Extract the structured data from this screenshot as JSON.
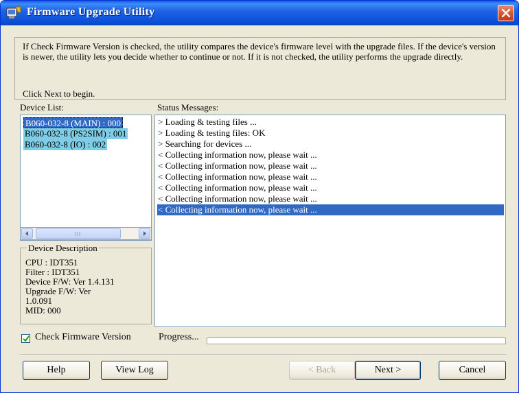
{
  "window": {
    "title": "Firmware Upgrade Utility",
    "close_icon": "close-icon",
    "app_icon": "firmware-icon"
  },
  "intro": {
    "text": "If Check Firmware Version is checked, the utility compares the device's firmware level with the upgrade files. If the device's version is newer, the utility lets you decide whether to continue or not. If it is not checked, the utility performs the upgrade directly.",
    "click_next": "Click Next to begin."
  },
  "device_list": {
    "label": "Device List:",
    "items": [
      {
        "label": "B060-032-8 (MAIN) : 000"
      },
      {
        "label": "B060-032-8 (PS2SIM) : 001"
      },
      {
        "label": "B060-032-8 (IO) : 002"
      }
    ]
  },
  "device_description": {
    "legend": "Device Description",
    "lines": [
      "CPU : IDT351",
      "Filter : IDT351",
      "Device F/W: Ver 1.4.131",
      "Upgrade F/W: Ver",
      "1.0.091",
      "MID: 000"
    ]
  },
  "status": {
    "label": "Status Messages:",
    "lines": [
      "> Loading & testing files ...",
      "> Loading & testing files: OK",
      "> Searching for devices ...",
      "< Collecting information now, please wait ...",
      "< Collecting information now, please wait ...",
      "< Collecting information now, please wait ...",
      "< Collecting information now, please wait ...",
      "< Collecting information now, please wait ...",
      "< Collecting information now, please wait ..."
    ]
  },
  "options": {
    "check_firmware_label": "Check Firmware Version",
    "check_firmware_checked": true,
    "progress_label": "Progress...",
    "progress_value": 0
  },
  "buttons": {
    "help": "Help",
    "view_log": "View Log",
    "back": "< Back",
    "next": "Next >",
    "cancel": "Cancel"
  }
}
